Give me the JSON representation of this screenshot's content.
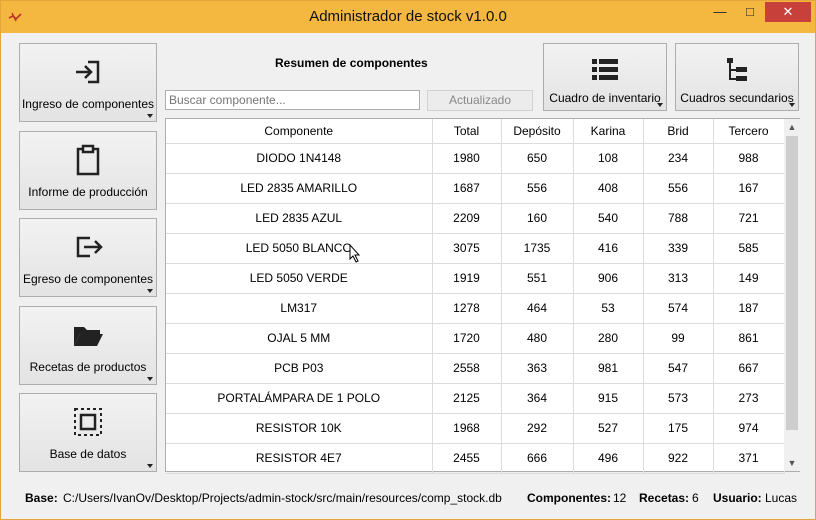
{
  "window": {
    "title": "Administrador de stock v1.0.0",
    "controls": {
      "minimize": "—",
      "maximize": "□",
      "close": "✕"
    }
  },
  "sidebar": {
    "buttons": [
      {
        "label": "Ingreso de componentes",
        "icon": "login-icon"
      },
      {
        "label": "Informe de producción",
        "icon": "clipboard-icon"
      },
      {
        "label": "Egreso de componentes",
        "icon": "logout-icon"
      },
      {
        "label": "Recetas de productos",
        "icon": "folder-open-icon"
      },
      {
        "label": "Base de datos",
        "icon": "database-select-icon"
      }
    ]
  },
  "summary": {
    "title": "Resumen de componentes",
    "search_placeholder": "Buscar componente...",
    "updated_label": "Actualizado"
  },
  "toolbar": {
    "inventory_label": "Cuadro de inventario",
    "secondary_label": "Cuadros secundarios"
  },
  "table": {
    "columns": [
      "Componente",
      "Total",
      "Depósito",
      "Karina",
      "Brid",
      "Tercero"
    ],
    "rows": [
      [
        "DIODO 1N4148",
        "1980",
        "650",
        "108",
        "234",
        "988"
      ],
      [
        "LED 2835 AMARILLO",
        "1687",
        "556",
        "408",
        "556",
        "167"
      ],
      [
        "LED 2835 AZUL",
        "2209",
        "160",
        "540",
        "788",
        "721"
      ],
      [
        "LED 5050 BLANCO",
        "3075",
        "1735",
        "416",
        "339",
        "585"
      ],
      [
        "LED 5050 VERDE",
        "1919",
        "551",
        "906",
        "313",
        "149"
      ],
      [
        "LM317",
        "1278",
        "464",
        "53",
        "574",
        "187"
      ],
      [
        "OJAL 5 MM",
        "1720",
        "480",
        "280",
        "99",
        "861"
      ],
      [
        "PCB P03",
        "2558",
        "363",
        "981",
        "547",
        "667"
      ],
      [
        "PORTALÁMPARA DE 1 POLO",
        "2125",
        "364",
        "915",
        "573",
        "273"
      ],
      [
        "RESISTOR 10K",
        "1968",
        "292",
        "527",
        "175",
        "974"
      ],
      [
        "RESISTOR 4E7",
        "2455",
        "666",
        "496",
        "922",
        "371"
      ]
    ]
  },
  "status": {
    "base_label": "Base:",
    "base_path": "C:/Users/IvanOv/Desktop/Projects/admin-stock/src/main/resources/comp_stock.db",
    "components_label": "Componentes:",
    "components_value": "12",
    "recipes_label": "Recetas:",
    "recipes_value": "6",
    "user_label": "Usuario:",
    "user_value": "Lucas"
  },
  "colors": {
    "titlebar": "#f4b740",
    "close_button": "#c7413a",
    "background": "#f0f0f0"
  }
}
